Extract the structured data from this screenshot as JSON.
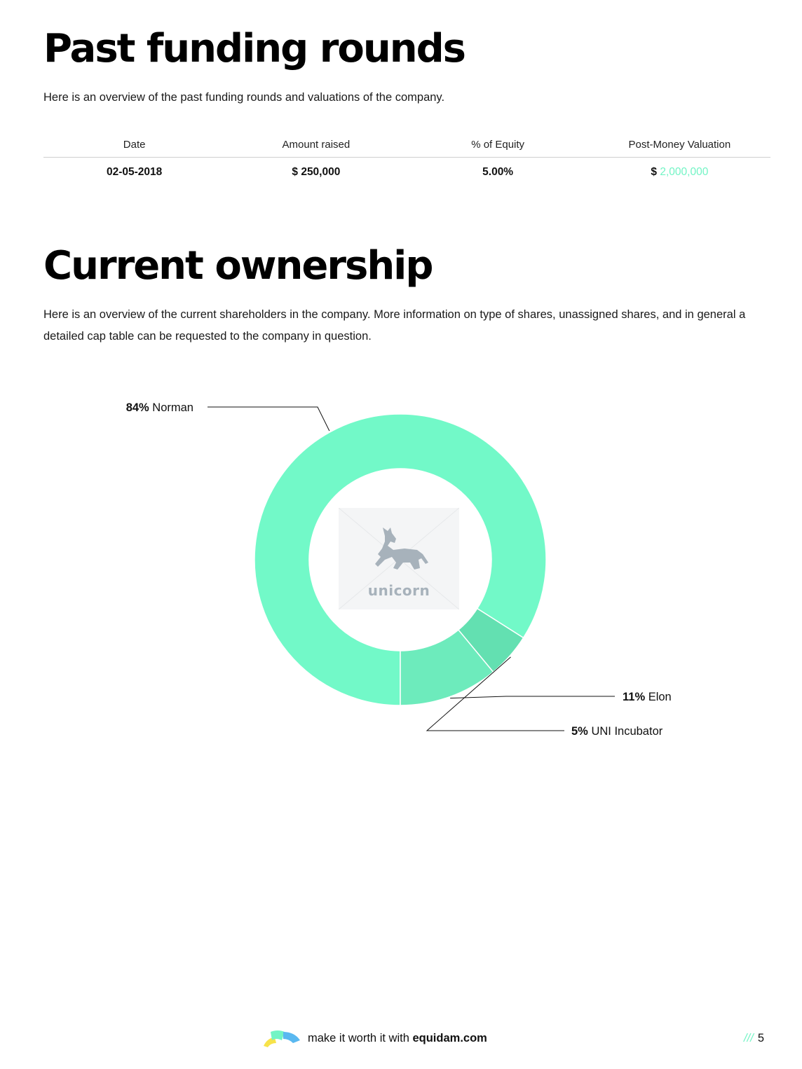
{
  "funding": {
    "title": "Past funding rounds",
    "intro": "Here is an overview of the past funding rounds and valuations of the company.",
    "columns": [
      "Date",
      "Amount raised",
      "% of Equity",
      "Post-Money Valuation"
    ],
    "rows": [
      {
        "date": "02-05-2018",
        "amount": "$ 250,000",
        "equity": "5.00%",
        "valuation_currency": "$",
        "valuation_amount": "2,000,000"
      }
    ]
  },
  "ownership": {
    "title": "Current ownership",
    "intro": "Here is an overview of the current shareholders in the company. More information on type of shares, unassigned shares, and in general a detailed cap table can be requested to the company in question.",
    "logo_text": "unicorn"
  },
  "chart_data": {
    "type": "pie",
    "variant": "donut",
    "slices": [
      {
        "name": "Norman",
        "label": "84%",
        "value": 84,
        "color": "#72f9c8"
      },
      {
        "name": "Elon",
        "label": "11%",
        "value": 11,
        "color": "#6debbc"
      },
      {
        "name": "UNI Incubator",
        "label": "5%",
        "value": 5,
        "color": "#63e0b1"
      }
    ],
    "legend": "leader-line labels"
  },
  "footer": {
    "tagline": "make it worth it with",
    "brand": "equidam.com",
    "page_prefix": "///",
    "page_number": "5"
  },
  "colors": {
    "accent": "#72f4c5",
    "text": "#111111"
  }
}
